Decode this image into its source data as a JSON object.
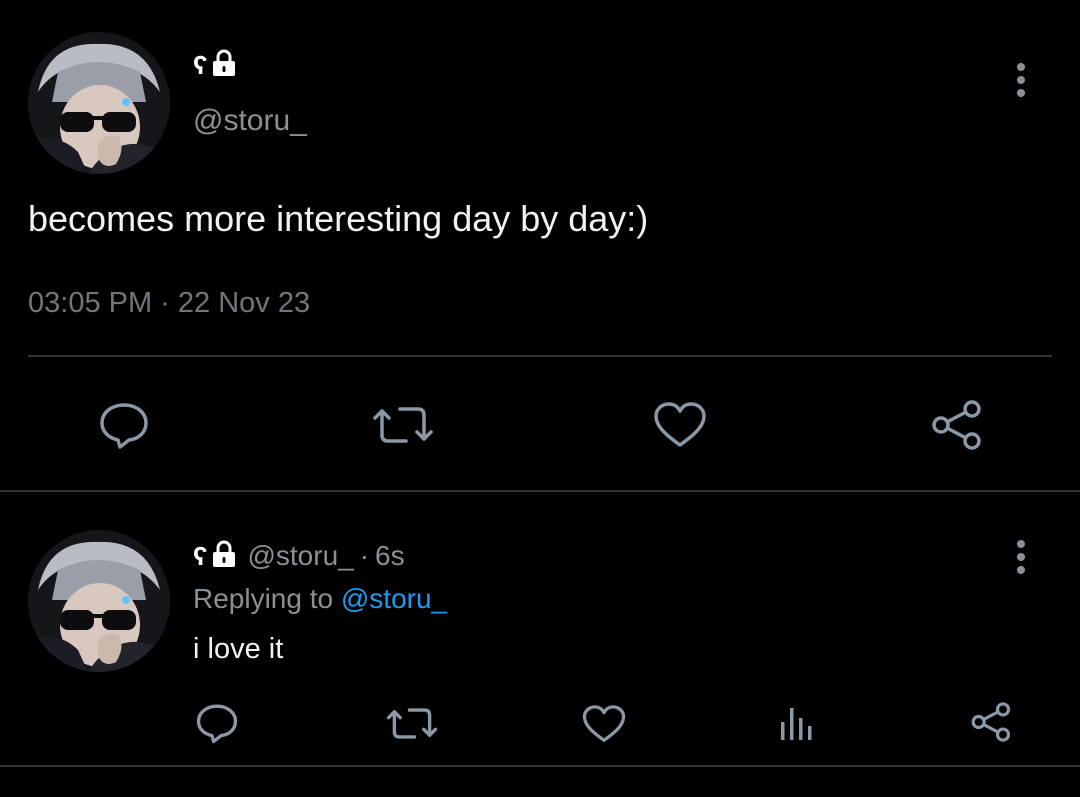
{
  "colors": {
    "background": "#000000",
    "text": "#e7e9ea",
    "muted": "#71767b",
    "link": "#1d9bf0",
    "divider": "#2f3336",
    "icon": "#8b98a5"
  },
  "main_tweet": {
    "name_glyph": "ʕ",
    "name_icon": "lock-icon",
    "handle": "@storu_",
    "text": "becomes more interesting day by day:)",
    "timestamp": "03:05 PM · 22 Nov 23",
    "actions": [
      "reply-icon",
      "retweet-icon",
      "like-icon",
      "share-icon"
    ]
  },
  "reply_tweet": {
    "name_glyph": "ʕ",
    "name_icon": "lock-icon",
    "handle": "@storu_",
    "separator": "·",
    "time_ago": "6s",
    "replying_to_label": "Replying to",
    "replying_to_handle": "@storu_",
    "text": "i love it",
    "actions": [
      "reply-icon",
      "retweet-icon",
      "like-icon",
      "views-icon",
      "share-icon"
    ]
  }
}
